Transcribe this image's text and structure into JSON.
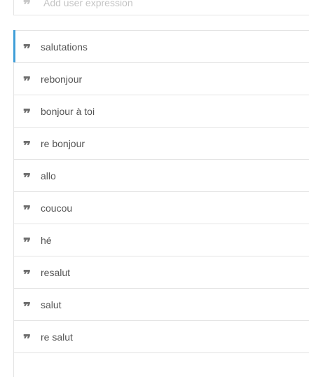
{
  "add_expression": {
    "placeholder": "Add user expression"
  },
  "expressions": [
    {
      "text": "salutations",
      "selected": true
    },
    {
      "text": "rebonjour"
    },
    {
      "text": "bonjour à toi"
    },
    {
      "text": "re bonjour"
    },
    {
      "text": "allo"
    },
    {
      "text": "coucou"
    },
    {
      "text": "hé"
    },
    {
      "text": "resalut"
    },
    {
      "text": "salut"
    },
    {
      "text": "re salut"
    }
  ],
  "colors": {
    "accent": "#3f9ed8",
    "border": "#e4e4e4",
    "icon": "#6d6d6d",
    "text": "#555555"
  },
  "icons": {
    "expression": "quote-icon"
  }
}
